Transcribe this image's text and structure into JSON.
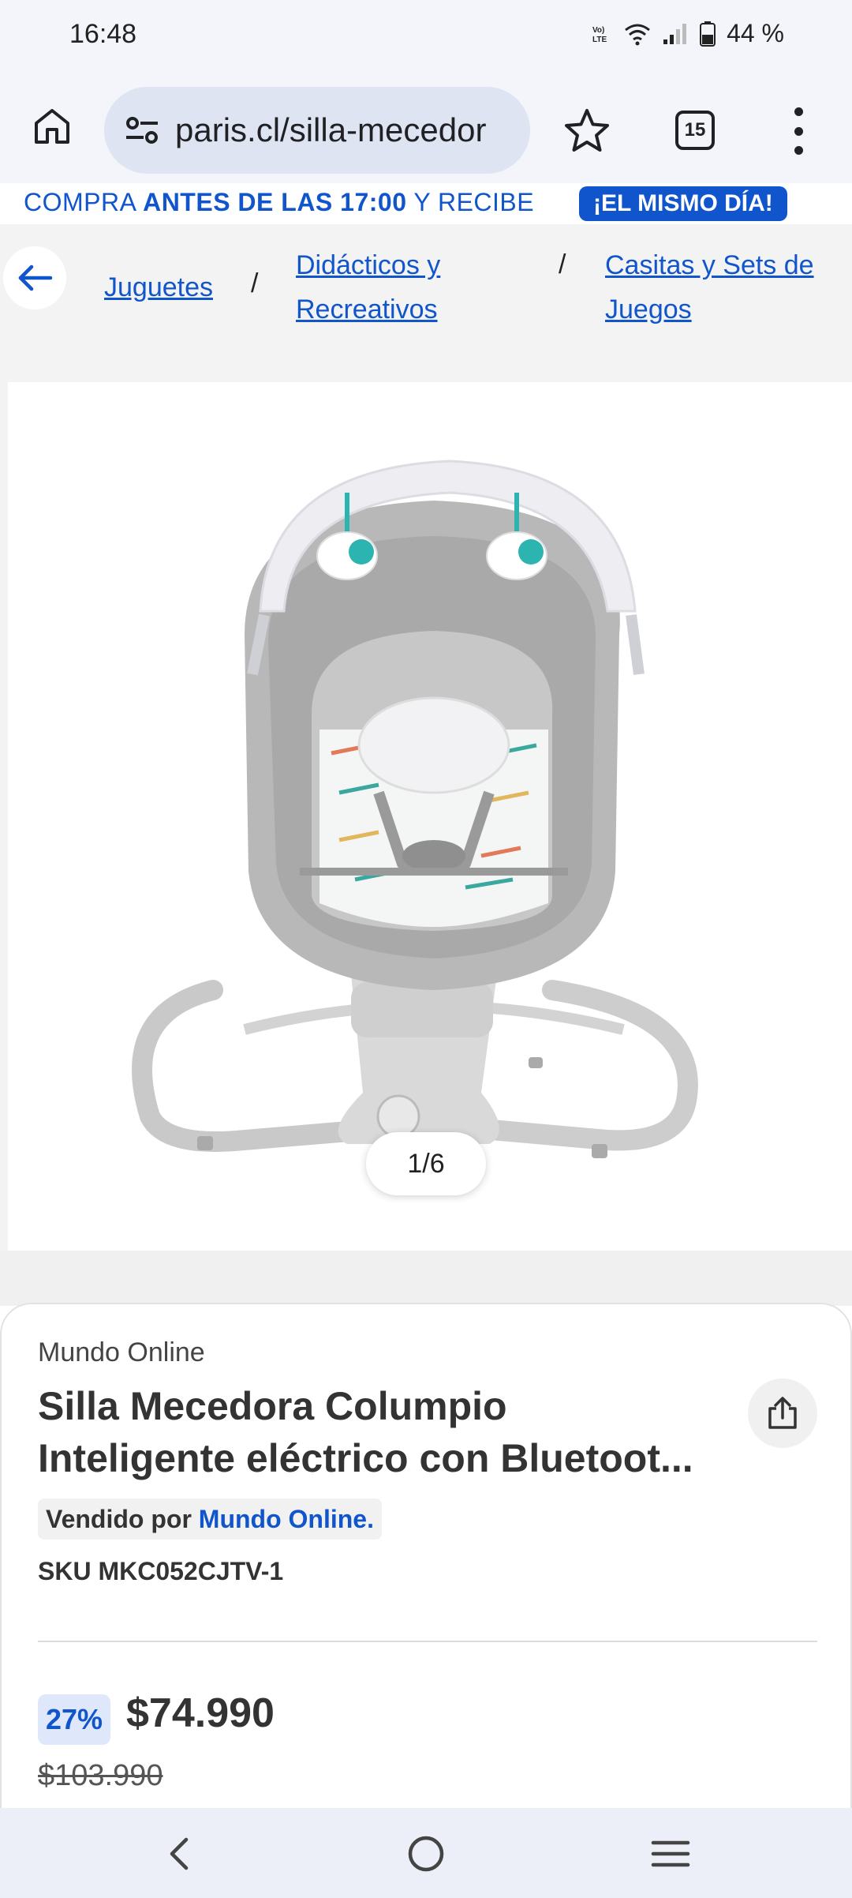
{
  "status_bar": {
    "time": "16:48",
    "battery_percent": "44 %",
    "icons": [
      "volte-icon",
      "wifi-icon",
      "signal-icon",
      "battery-icon"
    ]
  },
  "browser": {
    "url": "paris.cl/silla-mecedor",
    "tab_count": "15"
  },
  "promo": {
    "text_part1": "COMPRA ",
    "text_bold": "ANTES DE LAS 17:00",
    "text_part2": " Y RECIBE",
    "badge": "¡EL MISMO DÍA!"
  },
  "breadcrumb": {
    "items": [
      {
        "line1": "Juguetes",
        "line2": ""
      },
      {
        "line1": "Didácticos y",
        "line2": "Recreativos"
      },
      {
        "line1": "Casitas y Sets de",
        "line2": "Juegos"
      }
    ],
    "separator": "/"
  },
  "gallery": {
    "counter": "1/6"
  },
  "product": {
    "seller": "Mundo Online",
    "title_line1": "Silla Mecedora Columpio",
    "title_line2": "Inteligente eléctrico con Bluetoot...",
    "sold_by_label": "Vendido por",
    "sold_by_seller": "Mundo Online.",
    "sku": "SKU MKC052CJTV-1",
    "discount": "27%",
    "price": "$74.990",
    "old_price": "$103.990"
  },
  "colors": {
    "brand_blue": "#1155cc",
    "discount_bg": "#dfe8fb"
  }
}
